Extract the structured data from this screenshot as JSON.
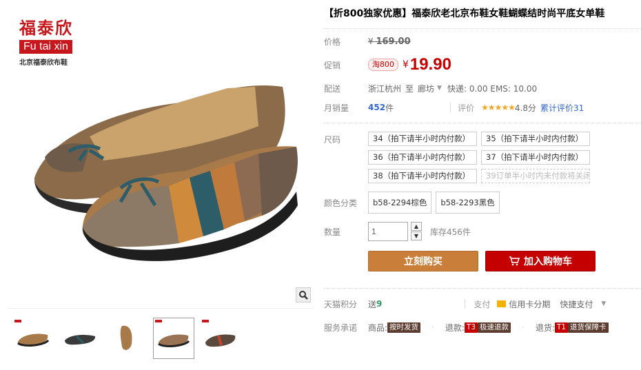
{
  "brand": {
    "name_cn": "福泰欣",
    "name_en": "Fu tai xin",
    "subtitle": "北京福泰欣布鞋"
  },
  "product": {
    "title": "【折800独家优惠】福泰欣老北京布鞋女鞋蝴蝶结时尚平底女单鞋"
  },
  "price": {
    "label": "价格",
    "currency": "¥",
    "original": "169.00"
  },
  "promo": {
    "label": "促销",
    "tag": "淘800",
    "currency": "¥",
    "price": "19.90"
  },
  "shipping": {
    "label": "配送",
    "from": "浙江杭州",
    "to_word": "至",
    "to": "廊坊",
    "fees": "快递: 0.00 EMS: 10.00"
  },
  "sales": {
    "label": "月销量",
    "count": "452",
    "unit": "件",
    "review_label": "评价",
    "stars": "★★★★★",
    "score": "4.8分",
    "total_reviews": "累计评价31"
  },
  "sizes": {
    "label": "尺码",
    "options": [
      {
        "text": "34（拍下请半小时内付款）",
        "disabled": false
      },
      {
        "text": "35（拍下请半小时内付款）",
        "disabled": false
      },
      {
        "text": "36（拍下请半小时内付款）",
        "disabled": false
      },
      {
        "text": "37（拍下请半小时内付款）",
        "disabled": false
      },
      {
        "text": "38（拍下请半小时内付款）",
        "disabled": false
      },
      {
        "text": "39订单半小时内未付款将关闭",
        "disabled": true
      }
    ]
  },
  "colors": {
    "label": "颜色分类",
    "options": [
      "b58-2294棕色",
      "b58-2293黑色"
    ]
  },
  "quantity": {
    "label": "数量",
    "value": "1",
    "stock": "库存456件"
  },
  "buttons": {
    "buy": "立刻购买",
    "cart": "加入购物车"
  },
  "points": {
    "label": "天猫积分",
    "gift_word": "送",
    "value": "9",
    "pay_label": "支付",
    "credit": "信用卡分期",
    "quick": "快捷支付"
  },
  "service": {
    "label": "服务承诺",
    "goods_word": "商品:",
    "goods_badge": "按时发货",
    "refund_word": "退款:",
    "refund_t3": "T3",
    "refund_badge": "极速退款",
    "return_word": "退货:",
    "return_t1": "T1",
    "return_badge": "退货保障卡"
  },
  "colors_theme": {
    "brand_red": "#c8161d",
    "price_red": "#c40000",
    "buy_button": "#c97f3a",
    "cart_button": "#c40000"
  }
}
